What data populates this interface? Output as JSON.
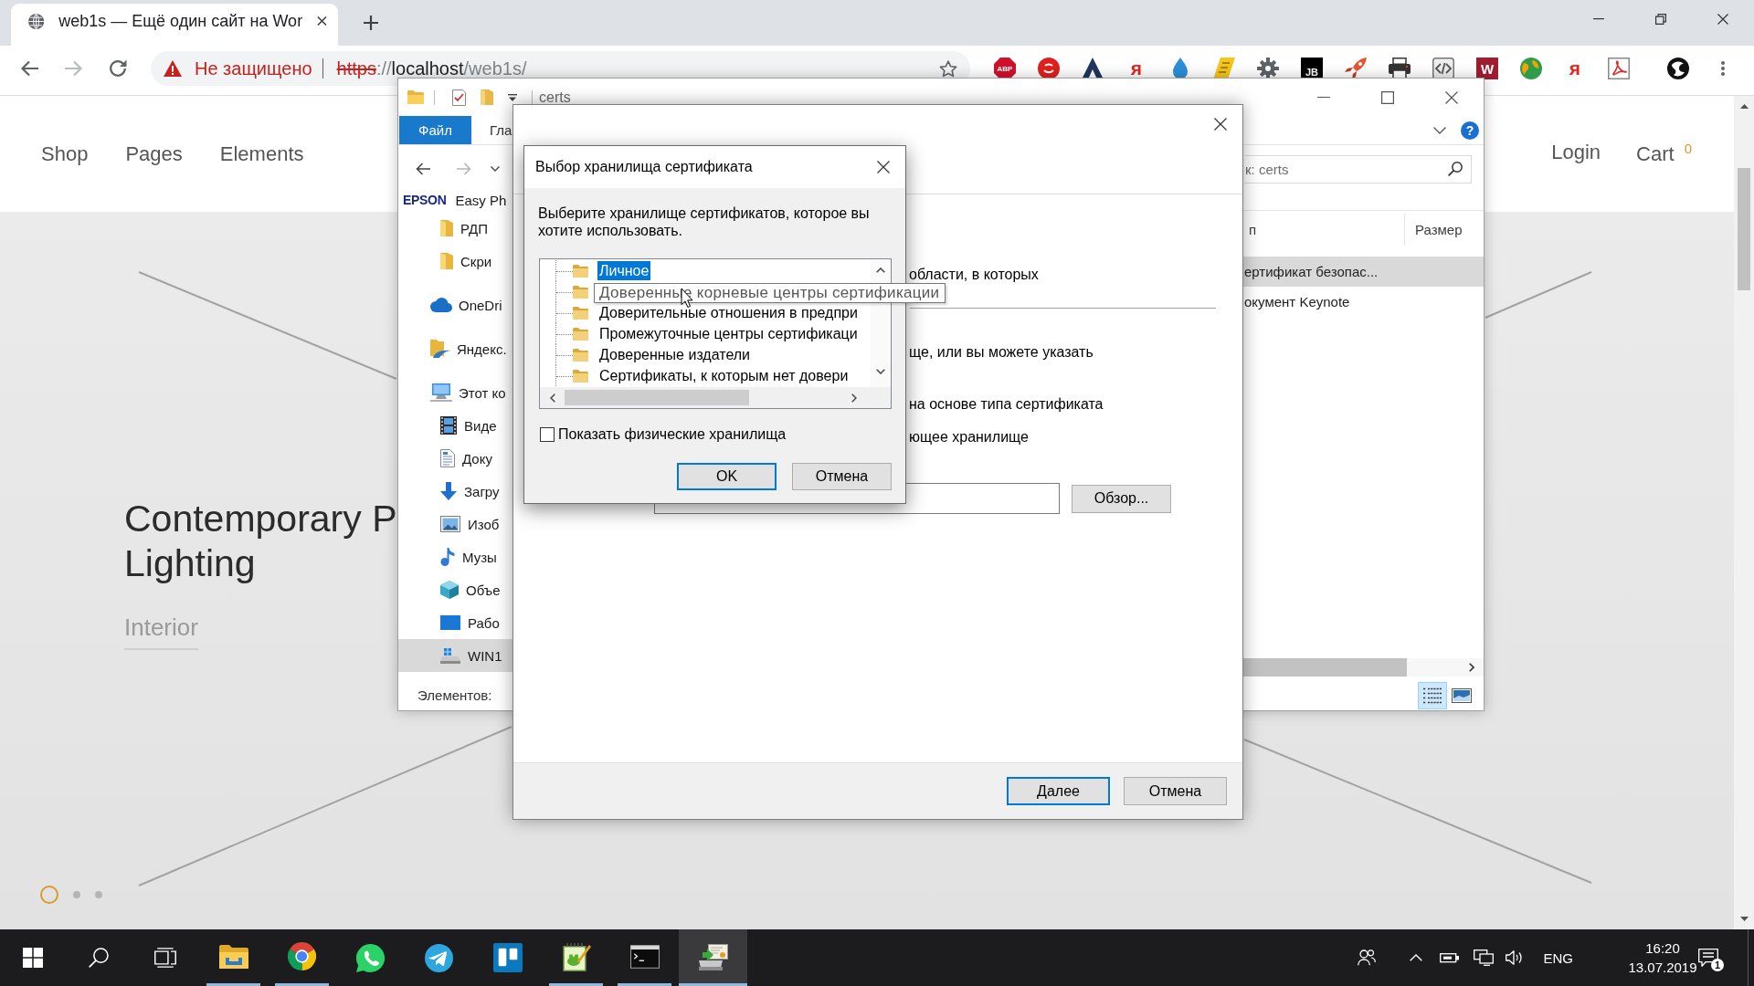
{
  "browser": {
    "tab": {
      "title": "web1s — Ещё один сайт на Wor"
    },
    "nav_buttons": [
      {
        "kind": "back",
        "disabled": false
      },
      {
        "kind": "forward",
        "disabled": true
      },
      {
        "kind": "reload",
        "disabled": false
      }
    ],
    "address_bar": {
      "security_label": "Не защищено",
      "url_parts": [
        {
          "kind": "scheme",
          "text": "https"
        },
        {
          "kind": "plain",
          "text": "://"
        },
        {
          "kind": "host",
          "text": "localhost"
        },
        {
          "kind": "plain",
          "text": "/web1s/"
        }
      ]
    },
    "extensions": [
      {
        "kind": "adblock",
        "glyph": "ABP"
      },
      {
        "kind": "disc"
      },
      {
        "kind": "peak"
      },
      {
        "kind": "letter",
        "glyph": "я"
      },
      {
        "kind": "drop"
      },
      {
        "kind": "note"
      },
      {
        "kind": "gear"
      },
      {
        "kind": "monogram",
        "glyph": "JB"
      },
      {
        "kind": "rocket"
      },
      {
        "kind": "printer"
      },
      {
        "kind": "code"
      },
      {
        "kind": "office",
        "glyph": "W"
      },
      {
        "kind": "globe"
      },
      {
        "kind": "letter",
        "glyph": "я"
      },
      {
        "kind": "pdf"
      }
    ]
  },
  "site": {
    "nav": [
      {
        "label": "Shop"
      },
      {
        "label": "Pages"
      },
      {
        "label": "Elements"
      }
    ],
    "login": "Login",
    "cart": {
      "label": "Cart",
      "count": "0"
    },
    "hero": {
      "title_lines": [
        "Contemporary P",
        "Lighting"
      ],
      "subtitle": "Interior",
      "slides": [
        {
          "selected": true
        },
        {
          "selected": false
        },
        {
          "selected": false
        }
      ]
    }
  },
  "explorer": {
    "title": "certs",
    "nav_buttons": [
      {
        "kind": "back",
        "disabled": false
      },
      {
        "kind": "forward",
        "disabled": true
      }
    ],
    "ribbon_tabs": [
      {
        "kind": "file",
        "label": "Файл"
      },
      {
        "kind": "tab",
        "label": "Гла"
      }
    ],
    "help": "?",
    "nav_pane": {
      "quick_access": [
        {
          "kind": "brand",
          "logo": "EPSON",
          "label": "Easy Ph",
          "selected": false
        },
        {
          "kind": "folder",
          "label": "РДП",
          "selected": false
        },
        {
          "kind": "folder",
          "label": "Скри",
          "selected": false
        }
      ],
      "locations": [
        {
          "kind": "cloud",
          "label": "OneDri",
          "selected": false
        },
        {
          "kind": "disk",
          "label": "Яндекс.",
          "selected": false
        },
        {
          "kind": "computer",
          "label": "Этот ко",
          "selected": false,
          "children": [
            {
              "kind": "video",
              "label": "Виде",
              "selected": false
            },
            {
              "kind": "documents",
              "label": "Доку",
              "selected": false
            },
            {
              "kind": "downloads",
              "label": "Загру",
              "selected": false
            },
            {
              "kind": "pictures",
              "label": "Изоб",
              "selected": false
            },
            {
              "kind": "music",
              "label": "Музы",
              "selected": false
            },
            {
              "kind": "objects",
              "label": "Объе",
              "selected": false
            },
            {
              "kind": "desktop",
              "label": "Рабо",
              "selected": false
            },
            {
              "kind": "drive",
              "label": "WIN1",
              "selected": true
            }
          ]
        }
      ]
    },
    "search": {
      "placeholder": "к: certs"
    },
    "columns": [
      {
        "label": "п"
      },
      {
        "label": "Размер"
      }
    ],
    "files": [
      {
        "cells": [
          "ертификат безопас..."
        ],
        "selected": true
      },
      {
        "cells": [
          "окумент Keynote"
        ],
        "selected": false
      }
    ],
    "status": "Элементов:",
    "view_buttons": [
      {
        "kind": "details",
        "selected": true
      },
      {
        "kind": "preview",
        "selected": false
      }
    ]
  },
  "import_wizard": {
    "lines": [
      "области, в которых",
      "ще, или вы можете указать",
      "на основе типа сертификата",
      "ющее хранилище"
    ],
    "browse_button": "Обзор...",
    "buttons": [
      {
        "label": "Далее",
        "default": true
      },
      {
        "label": "Отмена",
        "default": false
      }
    ]
  },
  "store_dialog": {
    "title": "Выбор хранилища сертификата",
    "prompt": "Выберите хранилище сертификатов, которое вы хотите использовать.",
    "stores": [
      {
        "label": "Личное",
        "selected": true
      },
      {
        "tooltip": "Доверенные корневые центры сертификации",
        "selected": false
      },
      {
        "label": "Доверительные отношения в предпри",
        "selected": false
      },
      {
        "label": "Промежуточные центры сертификаци",
        "selected": false
      },
      {
        "label": "Доверенные издатели",
        "selected": false
      },
      {
        "label": "Сертификаты, к которым нет довери",
        "selected": false
      }
    ],
    "show_physical": {
      "label": "Показать физические хранилища",
      "checked": false
    },
    "buttons": [
      {
        "label": "OK",
        "default": true
      },
      {
        "label": "Отмена",
        "default": false
      }
    ]
  },
  "taskbar": {
    "apps": [
      {
        "kind": "explorer",
        "running": true,
        "active": false
      },
      {
        "kind": "browser",
        "running": true,
        "active": false
      },
      {
        "kind": "chat",
        "running": false,
        "active": false
      },
      {
        "kind": "messenger",
        "running": false,
        "active": false
      },
      {
        "kind": "board",
        "running": false,
        "active": false
      },
      {
        "kind": "notebook",
        "running": true,
        "active": false
      },
      {
        "kind": "terminal",
        "running": true,
        "active": false
      },
      {
        "kind": "console",
        "running": true,
        "active": true
      }
    ],
    "tray": {
      "language": "ENG",
      "time": "16:20",
      "date": "13.07.2019",
      "notification_count": "1"
    }
  }
}
